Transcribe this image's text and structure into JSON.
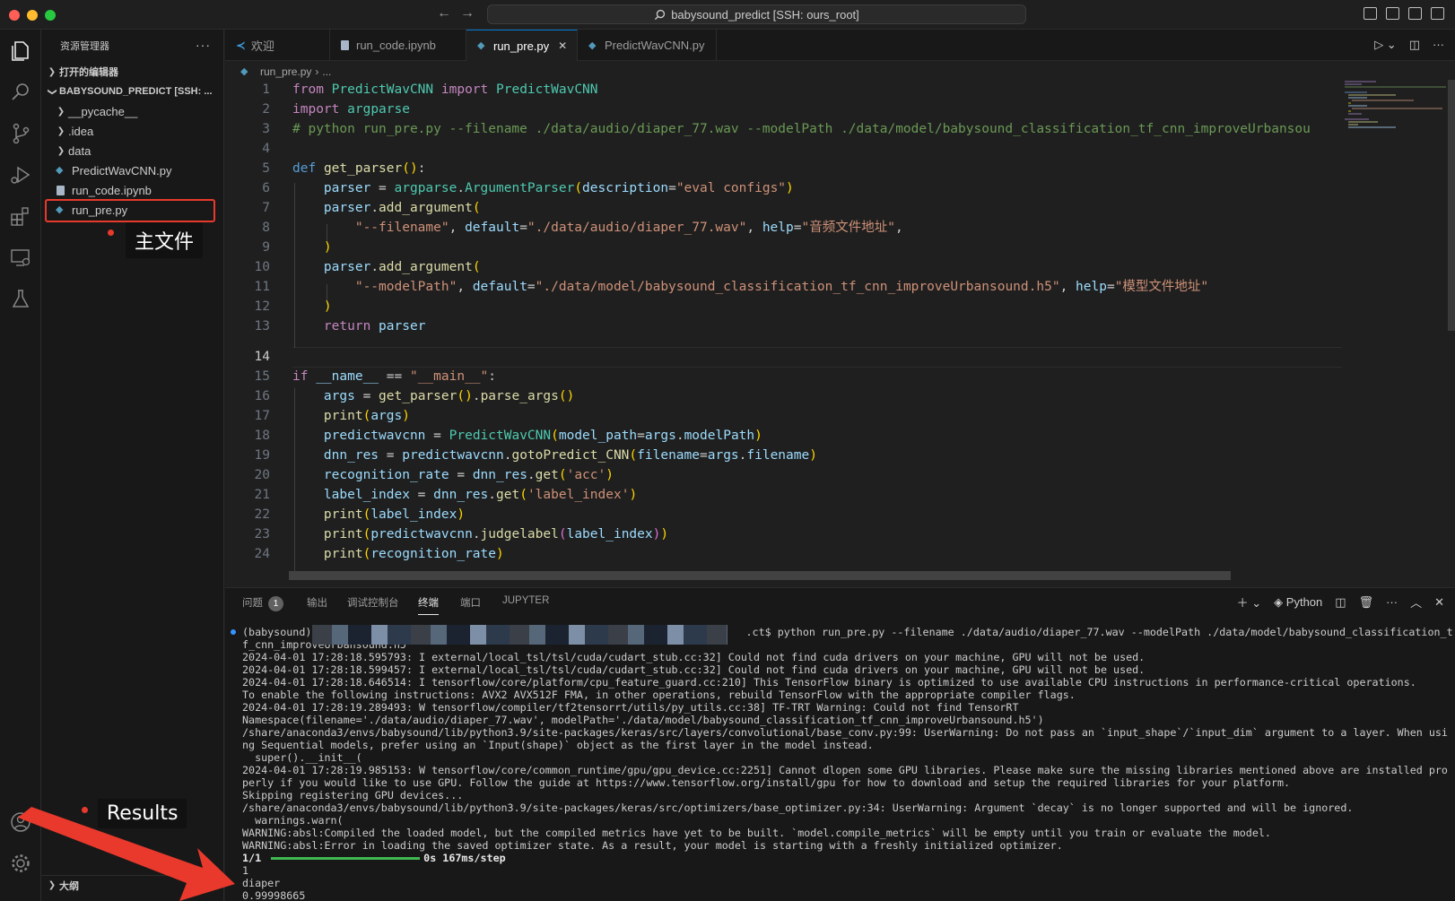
{
  "window": {
    "command_center": "babysound_predict [SSH: ours_root]",
    "colors": {
      "accent": "#0078d4",
      "annotation": "#e8392c"
    }
  },
  "sidebar": {
    "title": "资源管理器",
    "open_editors": "打开的编辑器",
    "workspace": "BABYSOUND_PREDICT [SSH: ...",
    "items": [
      {
        "label": "__pycache__",
        "type": "folder"
      },
      {
        "label": ".idea",
        "type": "folder"
      },
      {
        "label": "data",
        "type": "folder"
      },
      {
        "label": "PredictWavCNN.py",
        "type": "python"
      },
      {
        "label": "run_code.ipynb",
        "type": "notebook"
      },
      {
        "label": "run_pre.py",
        "type": "python"
      }
    ],
    "outline": "大纲"
  },
  "annotations": {
    "main_file": "主文件",
    "results": "Results"
  },
  "tabs": [
    {
      "label": "欢迎"
    },
    {
      "label": "run_code.ipynb"
    },
    {
      "label": "run_pre.py"
    },
    {
      "label": "PredictWavCNN.py"
    }
  ],
  "breadcrumb": {
    "file": "run_pre.py",
    "rest": "..."
  },
  "editor": {
    "current_line": 14,
    "line_numbers": [
      "1",
      "2",
      "3",
      "4",
      "5",
      "6",
      "7",
      "8",
      "9",
      "10",
      "11",
      "12",
      "13",
      "14",
      "15",
      "16",
      "17",
      "18",
      "19",
      "20",
      "21",
      "22",
      "23",
      "24"
    ],
    "code": {
      "l1_from": "from",
      "l1_mod": "PredictWavCNN",
      "l1_import": "import",
      "l1_cls": "PredictWavCNN",
      "l2_import": "import",
      "l2_mod": "argparse",
      "l3_comment": "# python run_pre.py --filename ./data/audio/diaper_77.wav --modelPath ./data/model/babysound_classification_tf_cnn_improveUrbansou",
      "l5_def": "def",
      "l5_fn": "get_parser",
      "l6_var": "parser",
      "l6_mod": "argparse",
      "l6_cls": "ArgumentParser",
      "l6_param": "description",
      "l6_str": "\"eval configs\"",
      "l7_var": "parser",
      "l7_fn": "add_argument",
      "l8_str1": "\"--filename\"",
      "l8_p1": "default",
      "l8_str2": "\"./data/audio/diaper_77.wav\"",
      "l8_p2": "help",
      "l8_str3": "\"音频文件地址\"",
      "l10_var": "parser",
      "l10_fn": "add_argument",
      "l11_str1": "\"--modelPath\"",
      "l11_p1": "default",
      "l11_str2": "\"./data/model/babysound_classification_tf_cnn_improveUrbansound.h5\"",
      "l11_p2": "help",
      "l11_str3": "\"模型文件地址\"",
      "l13_return": "return",
      "l13_var": "parser",
      "l15_if": "if",
      "l15_name": "__name__",
      "l15_str": "\"__main__\"",
      "l16_var": "args",
      "l16_fn1": "get_parser",
      "l16_fn2": "parse_args",
      "l17_fn": "print",
      "l17_var": "args",
      "l18_var": "predictwavcnn",
      "l18_cls": "PredictWavCNN",
      "l18_param": "model_path",
      "l18_arg": "args",
      "l18_attr": "modelPath",
      "l19_var": "dnn_res",
      "l19_obj": "predictwavcnn",
      "l19_fn": "gotoPredict_CNN",
      "l19_param": "filename",
      "l19_arg": "args",
      "l19_attr": "filename",
      "l20_var": "recognition_rate",
      "l20_obj": "dnn_res",
      "l20_fn": "get",
      "l20_str": "'acc'",
      "l21_var": "label_index",
      "l21_obj": "dnn_res",
      "l21_fn": "get",
      "l21_str": "'label_index'",
      "l22_fn": "print",
      "l22_var": "label_index",
      "l23_fn": "print",
      "l23_obj": "predictwavcnn",
      "l23_fn2": "judgelabel",
      "l23_var": "label_index",
      "l24_fn": "print",
      "l24_var": "recognition_rate"
    }
  },
  "panel": {
    "tabs": [
      "问题",
      "输出",
      "调试控制台",
      "终端",
      "端口",
      "JUPYTER"
    ],
    "problems_count": "1",
    "shell": "Python",
    "terminal": {
      "prompt_start": "(babysound) (b",
      "prompt_end": ".ct$ python run_pre.py --filename ./data/audio/diaper_77.wav --modelPath ./data/model/babysound_classification_t",
      "lines": [
        "f_cnn_improveUrbansound.h5",
        "2024-04-01 17:28:18.595793: I external/local_tsl/tsl/cuda/cudart_stub.cc:32] Could not find cuda drivers on your machine, GPU will not be used.",
        "2024-04-01 17:28:18.599457: I external/local_tsl/tsl/cuda/cudart_stub.cc:32] Could not find cuda drivers on your machine, GPU will not be used.",
        "2024-04-01 17:28:18.646514: I tensorflow/core/platform/cpu_feature_guard.cc:210] This TensorFlow binary is optimized to use available CPU instructions in performance-critical operations.",
        "To enable the following instructions: AVX2 AVX512F FMA, in other operations, rebuild TensorFlow with the appropriate compiler flags.",
        "2024-04-01 17:28:19.289493: W tensorflow/compiler/tf2tensorrt/utils/py_utils.cc:38] TF-TRT Warning: Could not find TensorRT",
        "Namespace(filename='./data/audio/diaper_77.wav', modelPath='./data/model/babysound_classification_tf_cnn_improveUrbansound.h5')",
        "/share/anaconda3/envs/babysound/lib/python3.9/site-packages/keras/src/layers/convolutional/base_conv.py:99: UserWarning: Do not pass an `input_shape`/`input_dim` argument to a layer. When usi",
        "ng Sequential models, prefer using an `Input(shape)` object as the first layer in the model instead.",
        "  super().__init__(",
        "2024-04-01 17:28:19.985153: W tensorflow/core/common_runtime/gpu/gpu_device.cc:2251] Cannot dlopen some GPU libraries. Please make sure the missing libraries mentioned above are installed pro",
        "perly if you would like to use GPU. Follow the guide at https://www.tensorflow.org/install/gpu for how to download and setup the required libraries for your platform.",
        "Skipping registering GPU devices...",
        "/share/anaconda3/envs/babysound/lib/python3.9/site-packages/keras/src/optimizers/base_optimizer.py:34: UserWarning: Argument `decay` is no longer supported and will be ignored.",
        "  warnings.warn(",
        "WARNING:absl:Compiled the loaded model, but the compiled metrics have yet to be built. `model.compile_metrics` will be empty until you train or evaluate the model.",
        "WARNING:absl:Error in loading the saved optimizer state. As a result, your model is starting with a freshly initialized optimizer."
      ],
      "progress_steps": "1/1",
      "progress_time": "0s 167ms/step",
      "results": [
        "1",
        "diaper",
        "0.99998665"
      ]
    }
  }
}
